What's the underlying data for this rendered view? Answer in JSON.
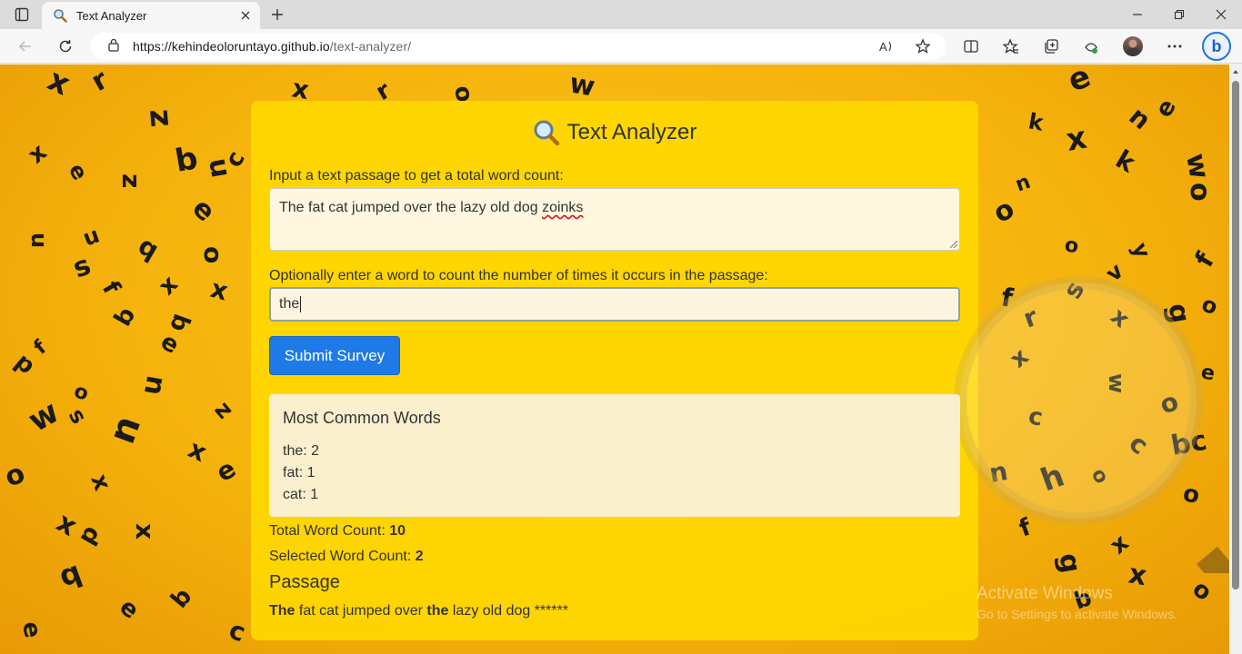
{
  "browser": {
    "tab_title": "Text Analyzer",
    "url_host": "https://kehindeoloruntayo.github.io",
    "url_path": "/text-analyzer/"
  },
  "page": {
    "heading": "Text Analyzer",
    "passage_label": "Input a text passage to get a total word count:",
    "passage_value_before": "The fat cat jumped over the lazy old dog ",
    "passage_value_misspelled": "zoinks",
    "word_label": "Optionally enter a word to count the number of times it occurs in the passage:",
    "word_value": "the",
    "submit_label": "Submit Survey",
    "common_words_title": "Most Common Words",
    "common_words": [
      "the: 2",
      "fat: 1",
      "cat: 1"
    ],
    "total_label": "Total Word Count: ",
    "total_value": "10",
    "selected_label": "Selected Word Count: ",
    "selected_value": "2",
    "passage_heading": "Passage",
    "passage_output": [
      {
        "text": "The",
        "bold": true
      },
      {
        "text": " fat cat jumped over ",
        "bold": false
      },
      {
        "text": "the",
        "bold": true
      },
      {
        "text": " lazy old dog ******",
        "bold": false
      }
    ]
  },
  "watermark": {
    "line1": "Activate Windows",
    "line2": "Go to Settings to activate Windows."
  },
  "colors": {
    "accent": "#1e7ae6",
    "card": "#ffd800",
    "background": "#f5b30c"
  },
  "icons": [
    "tab-actions-icon",
    "magnifier-icon",
    "close-icon",
    "plus-icon",
    "minimize-icon",
    "restore-icon",
    "back-icon",
    "refresh-icon",
    "lock-icon",
    "read-aloud-icon",
    "favorite-icon",
    "split-screen-icon",
    "favorites-icon",
    "collections-icon",
    "performance-icon",
    "more-icon",
    "bing-icon"
  ]
}
